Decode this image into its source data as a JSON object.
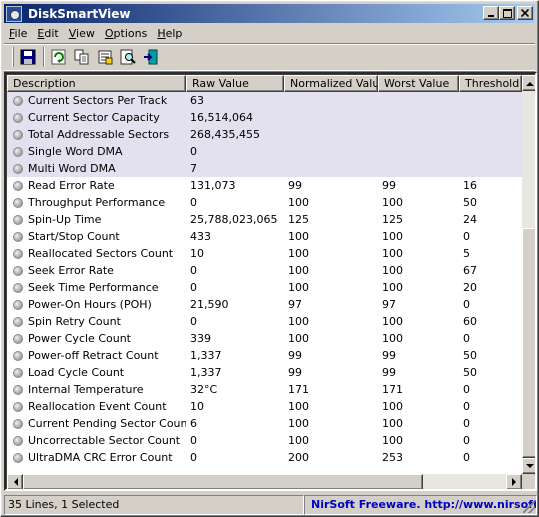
{
  "window": {
    "title": "DiskSmartView"
  },
  "menu": [
    "File",
    "Edit",
    "View",
    "Options",
    "Help"
  ],
  "toolbar": {
    "buttons": [
      "save-icon",
      "refresh-icon",
      "copy-icon",
      "properties-icon",
      "find-icon",
      "exit-icon"
    ]
  },
  "columns": [
    "Description",
    "Raw Value",
    "Normalized Value",
    "Worst Value",
    "Threshold ..."
  ],
  "rows": [
    {
      "description": "Current Sectors Per Track",
      "raw": "63",
      "normalized": "",
      "worst": "",
      "threshold": "",
      "selected": true
    },
    {
      "description": "Current Sector Capacity",
      "raw": "16,514,064",
      "normalized": "",
      "worst": "",
      "threshold": "",
      "selected": true
    },
    {
      "description": "Total Addressable Sectors",
      "raw": "268,435,455",
      "normalized": "",
      "worst": "",
      "threshold": "",
      "selected": true
    },
    {
      "description": "Single Word DMA",
      "raw": "0",
      "normalized": "",
      "worst": "",
      "threshold": "",
      "selected": true
    },
    {
      "description": "Multi Word DMA",
      "raw": "7",
      "normalized": "",
      "worst": "",
      "threshold": "",
      "selected": true
    },
    {
      "description": "Read Error Rate",
      "raw": "131,073",
      "normalized": "99",
      "worst": "99",
      "threshold": "16",
      "selected": false
    },
    {
      "description": "Throughput Performance",
      "raw": "0",
      "normalized": "100",
      "worst": "100",
      "threshold": "50",
      "selected": false
    },
    {
      "description": "Spin-Up Time",
      "raw": "25,788,023,065",
      "normalized": "125",
      "worst": "125",
      "threshold": "24",
      "selected": false
    },
    {
      "description": "Start/Stop Count",
      "raw": "433",
      "normalized": "100",
      "worst": "100",
      "threshold": "0",
      "selected": false
    },
    {
      "description": "Reallocated Sectors Count",
      "raw": "10",
      "normalized": "100",
      "worst": "100",
      "threshold": "5",
      "selected": false
    },
    {
      "description": "Seek Error Rate",
      "raw": "0",
      "normalized": "100",
      "worst": "100",
      "threshold": "67",
      "selected": false
    },
    {
      "description": "Seek Time Performance",
      "raw": "0",
      "normalized": "100",
      "worst": "100",
      "threshold": "20",
      "selected": false
    },
    {
      "description": "Power-On Hours (POH)",
      "raw": "21,590",
      "normalized": "97",
      "worst": "97",
      "threshold": "0",
      "selected": false
    },
    {
      "description": "Spin Retry Count",
      "raw": "0",
      "normalized": "100",
      "worst": "100",
      "threshold": "60",
      "selected": false
    },
    {
      "description": "Power Cycle Count",
      "raw": "339",
      "normalized": "100",
      "worst": "100",
      "threshold": "0",
      "selected": false
    },
    {
      "description": "Power-off Retract Count",
      "raw": "1,337",
      "normalized": "99",
      "worst": "99",
      "threshold": "50",
      "selected": false
    },
    {
      "description": "Load Cycle Count",
      "raw": "1,337",
      "normalized": "99",
      "worst": "99",
      "threshold": "50",
      "selected": false
    },
    {
      "description": "Internal Temperature",
      "raw": "32°C",
      "normalized": "171",
      "worst": "171",
      "threshold": "0",
      "selected": false
    },
    {
      "description": "Reallocation Event Count",
      "raw": "10",
      "normalized": "100",
      "worst": "100",
      "threshold": "0",
      "selected": false
    },
    {
      "description": "Current Pending Sector Count",
      "raw": "6",
      "normalized": "100",
      "worst": "100",
      "threshold": "0",
      "selected": false
    },
    {
      "description": "Uncorrectable Sector Count",
      "raw": "0",
      "normalized": "100",
      "worst": "100",
      "threshold": "0",
      "selected": false
    },
    {
      "description": "UltraDMA CRC Error Count",
      "raw": "0",
      "normalized": "200",
      "worst": "253",
      "threshold": "0",
      "selected": false
    }
  ],
  "status": {
    "lines": "35 Lines, 1 Selected",
    "link": "NirSoft Freeware.  http://www.nirsoft.n"
  },
  "colors": {
    "selection": "#e3e1ef",
    "titlebar": "#0a246a",
    "link": "#0000c0"
  }
}
